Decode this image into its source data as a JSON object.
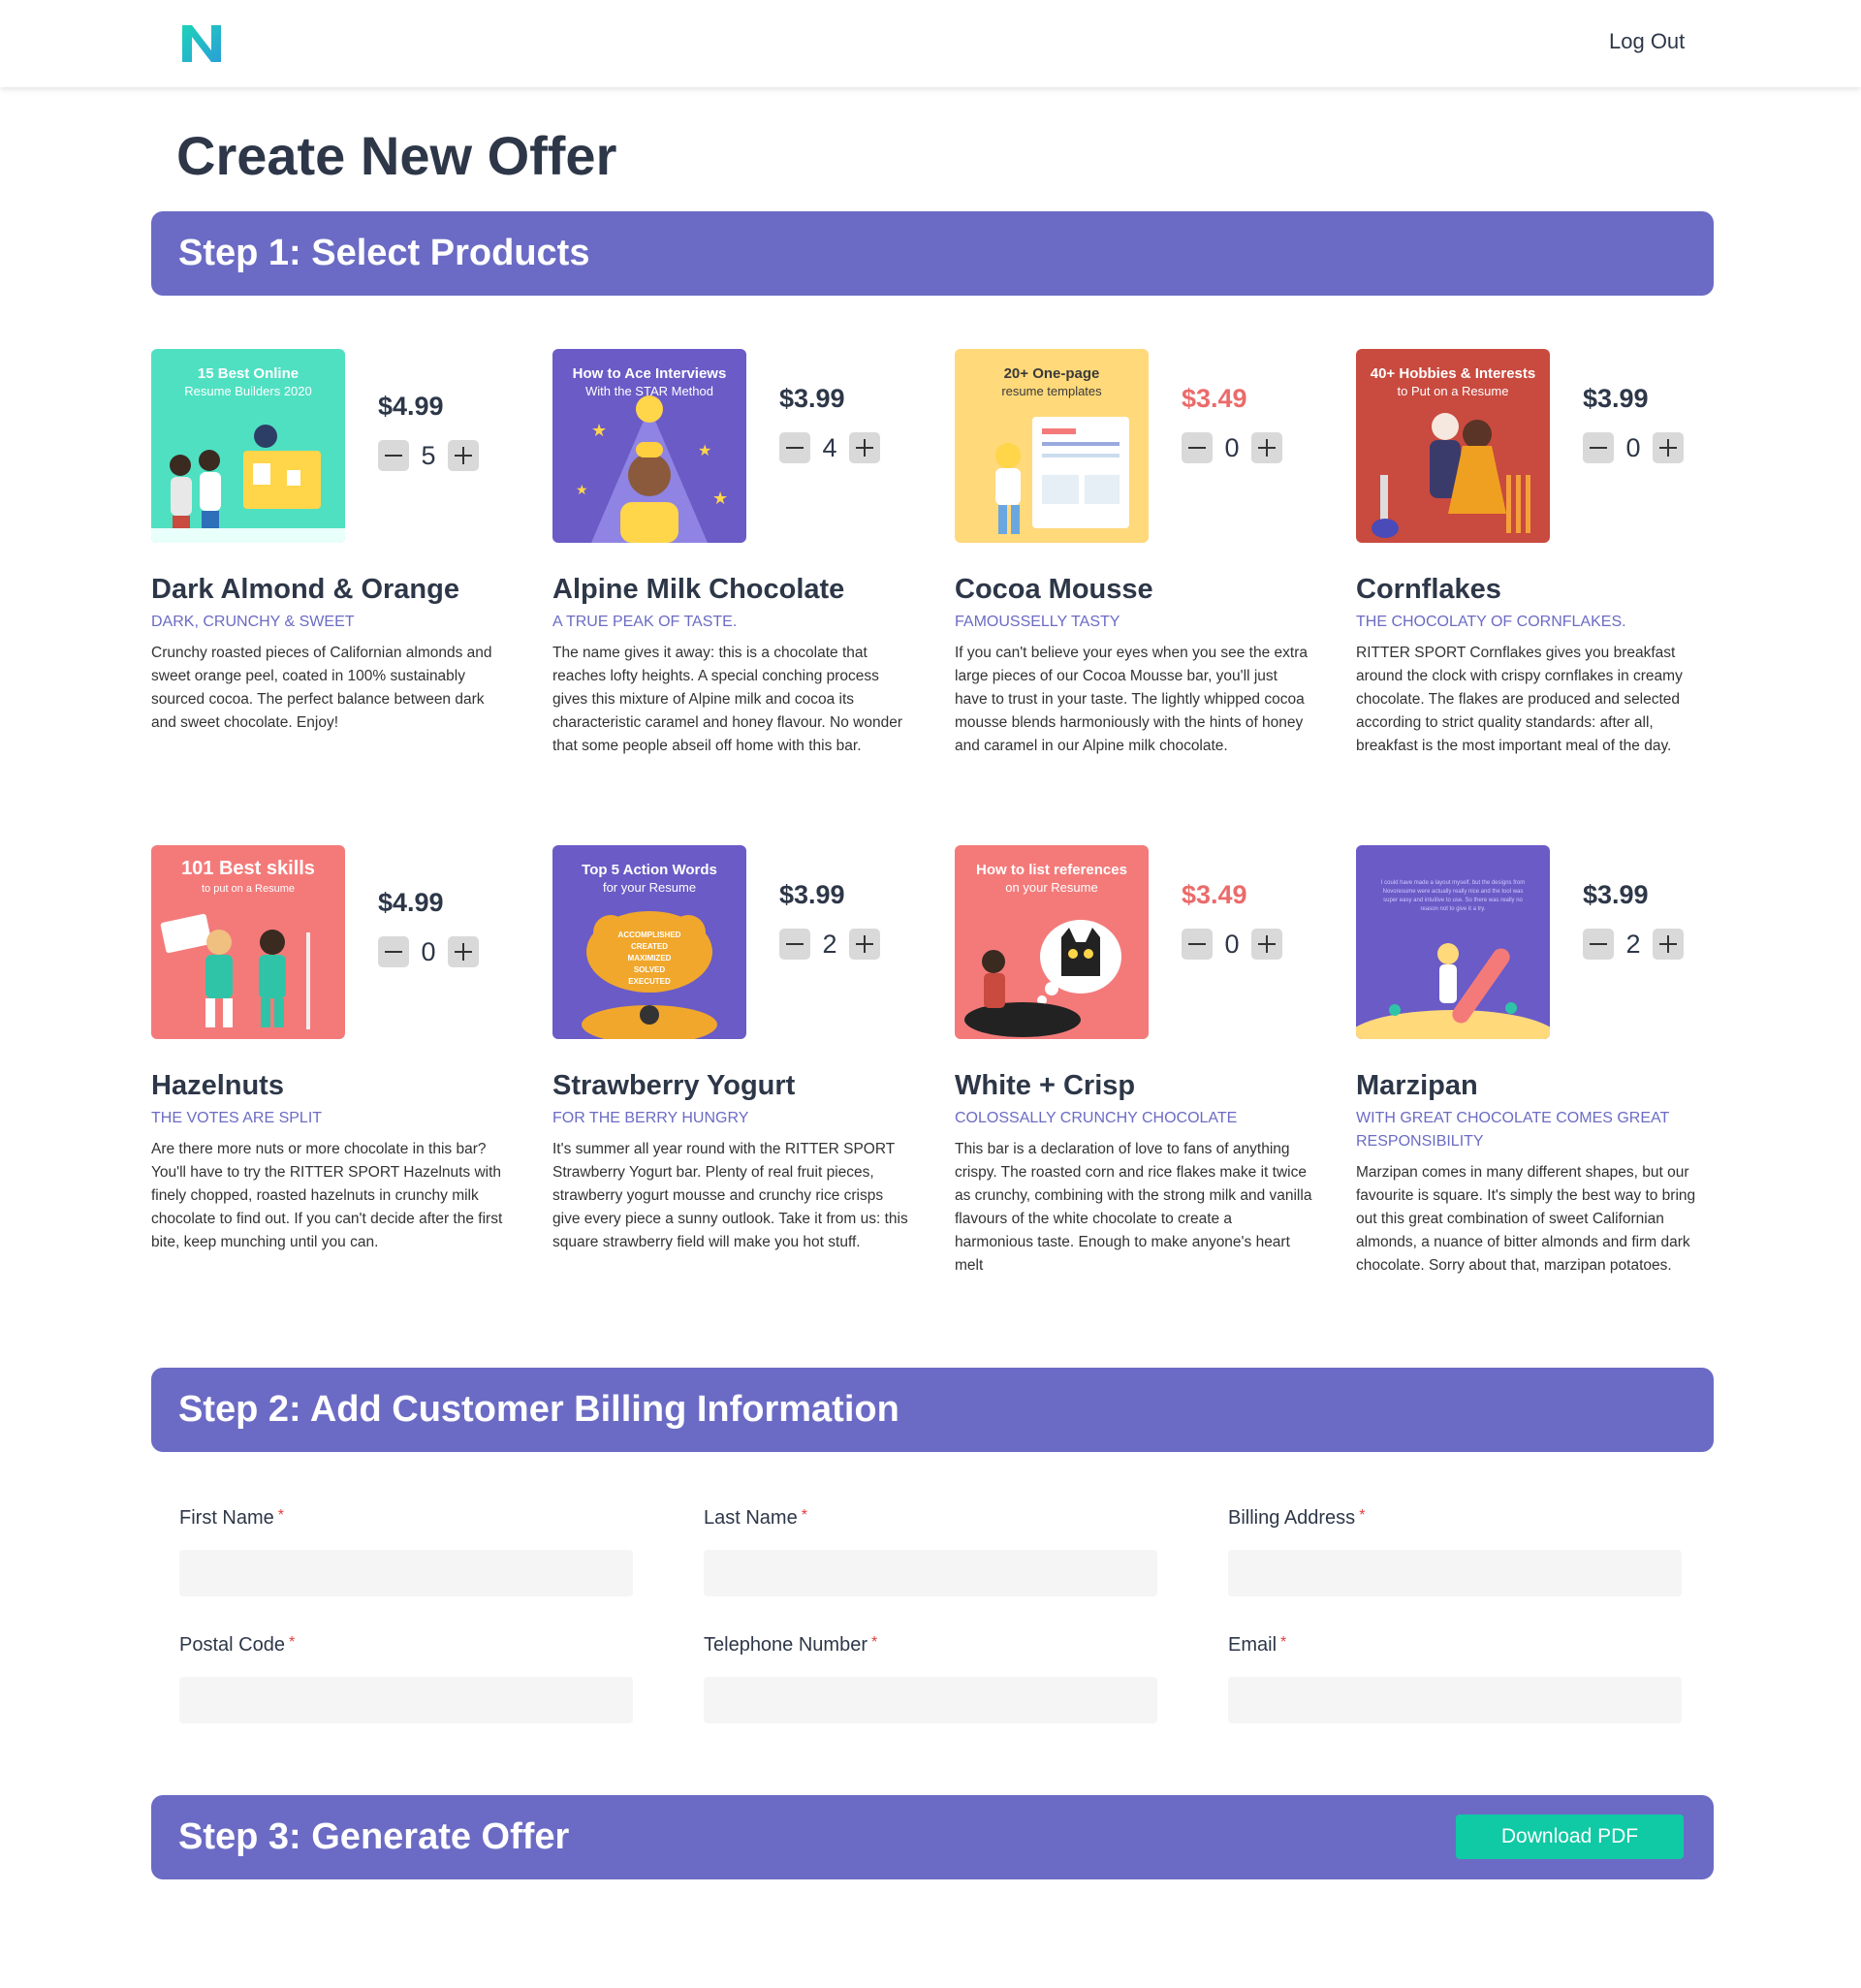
{
  "header": {
    "logout_label": "Log Out"
  },
  "page_title": "Create New Offer",
  "steps": {
    "step1": "Step 1: Select Products",
    "step2": "Step 2: Add Customer Billing Information",
    "step3": "Step 3: Generate Offer"
  },
  "products": [
    {
      "name": "Dark Almond & Orange",
      "tagline": "Dark, crunchy & sweet",
      "price": "$4.99",
      "quantity": "5",
      "on_sale": false,
      "description": "Crunchy roasted pieces of Californian almonds and sweet orange peel, coated in 100% sustainably sourced cocoa. The perfect balance between dark and sweet chocolate. Enjoy!",
      "image": {
        "bg": "#4fe0c2",
        "line1": "15 Best Online",
        "line2": "Resume Builders 2020"
      }
    },
    {
      "name": "Alpine Milk Chocolate",
      "tagline": "A true peak of taste.",
      "price": "$3.99",
      "quantity": "4",
      "on_sale": false,
      "description": "The name gives it away: this is a chocolate that reaches lofty heights. A special conching process gives this mixture of Alpine milk and cocoa its characteristic caramel and honey flavour. No wonder that some people abseil off home with this bar.",
      "image": {
        "bg": "#6a5bc6",
        "line1": "How to Ace Interviews",
        "line2": "With the STAR Method"
      }
    },
    {
      "name": "Cocoa Mousse",
      "tagline": "Famousselly tasty",
      "price": "$3.49",
      "quantity": "0",
      "on_sale": true,
      "description": "If you can't believe your eyes when you see the extra large pieces of our Cocoa Mousse bar, you'll just have to trust in your taste. The lightly whipped cocoa mousse blends harmoniously with the hints of honey and caramel in our Alpine milk chocolate.",
      "image": {
        "bg": "#ffd97a",
        "line1": "20+ One-page",
        "line2": "resume templates"
      }
    },
    {
      "name": "Cornflakes",
      "tagline": "The chocolaty of cornflakes.",
      "price": "$3.99",
      "quantity": "0",
      "on_sale": false,
      "description": "RITTER SPORT Cornflakes gives you breakfast around the clock with crispy cornflakes in creamy chocolate. The flakes are produced and selected according to strict quality standards: after all, breakfast is the most important meal of the day.",
      "image": {
        "bg": "#c94a3f",
        "line1": "40+ Hobbies & Interests",
        "line2": "to Put on a Resume"
      }
    },
    {
      "name": "Hazelnuts",
      "tagline": "The votes are split",
      "price": "$4.99",
      "quantity": "0",
      "on_sale": false,
      "description": "Are there more nuts or more chocolate in this bar?  You'll have to try the RITTER SPORT Hazelnuts with finely chopped, roasted hazelnuts in crunchy milk chocolate to find out. If you can't decide after the first bite, keep munching until you can.",
      "image": {
        "bg": "#f47a7a",
        "line1": "101 Best skills",
        "line2": "to put on a Resume"
      }
    },
    {
      "name": "Strawberry Yogurt",
      "tagline": "For the berry hungry",
      "price": "$3.99",
      "quantity": "2",
      "on_sale": false,
      "description": "It's summer all year round with the RITTER SPORT Strawberry Yogurt bar. Plenty of real fruit pieces, strawberry yogurt mousse and crunchy rice crisps give every piece a sunny outlook. Take it from us: this square strawberry field will make you hot stuff.",
      "image": {
        "bg": "#6a5bc6",
        "line1": "Top 5 Action Words",
        "line2": "for your Resume"
      }
    },
    {
      "name": "White + Crisp",
      "tagline": "Colossally crunchy chocolate",
      "price": "$3.49",
      "quantity": "0",
      "on_sale": true,
      "description": "This bar is a declaration of love to fans of anything crispy. The roasted corn and rice flakes make it twice as crunchy, combining with the strong milk and vanilla flavours of the white chocolate to create a harmonious taste. Enough to make anyone's heart melt",
      "image": {
        "bg": "#f47a7a",
        "line1": "How to list references",
        "line2": "on your Resume"
      }
    },
    {
      "name": "Marzipan",
      "tagline": "With great chocolate comes great responsibility",
      "price": "$3.99",
      "quantity": "2",
      "on_sale": false,
      "description": "Marzipan comes in many different shapes, but our favourite is square. It's simply the best way to bring out this great combination of sweet Californian almonds, a nuance of bitter almonds and firm dark chocolate.  Sorry about that, marzipan potatoes.",
      "image": {
        "bg": "#6a5bc6",
        "line1": "",
        "line2": ""
      }
    }
  ],
  "billing": {
    "first_name": "First Name",
    "last_name": "Last Name",
    "billing_address": "Billing Address",
    "postal_code": "Postal Code",
    "telephone": "Telephone Number",
    "email": "Email",
    "required_mark": "*"
  },
  "generate": {
    "download_label": "Download PDF"
  },
  "colors": {
    "accent": "#6b6bc5",
    "sale_price": "#eb6a6a",
    "download_button": "#10c9a5",
    "required": "#e53e3e"
  }
}
